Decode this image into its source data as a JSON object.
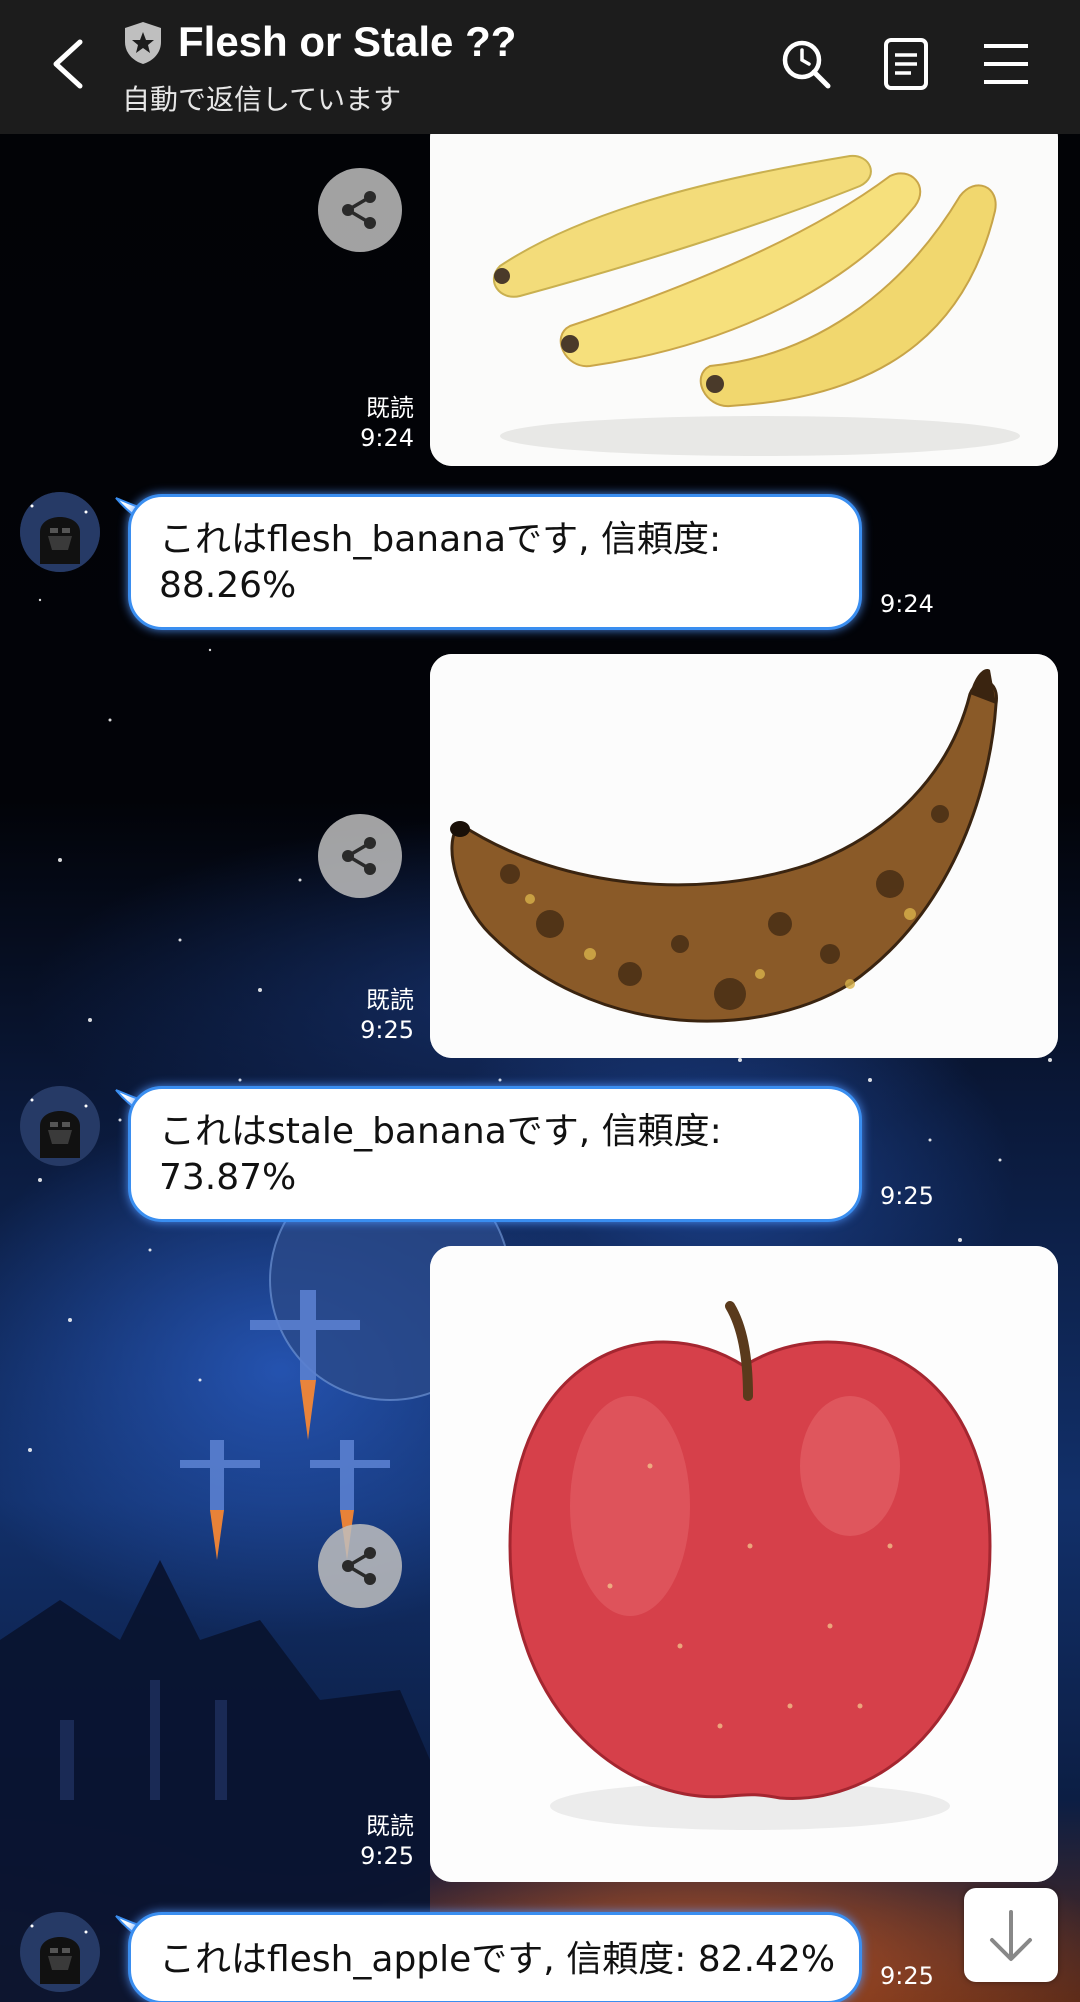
{
  "header": {
    "title": "Flesh or Stale ??",
    "subtitle": "自動で返信しています",
    "icons": [
      "back-arrow-icon",
      "shield-icon",
      "search-icon",
      "notes-icon",
      "menu-icon"
    ]
  },
  "messages": [
    {
      "type": "sent-image",
      "image": "yellow bananas",
      "read": "既読",
      "time": "9:24"
    },
    {
      "type": "received-text",
      "line1": "これはflesh_bananaです, 信頼度:",
      "line2": "88.26%",
      "time": "9:24"
    },
    {
      "type": "sent-image",
      "image": "overripe brown banana",
      "read": "既読",
      "time": "9:25"
    },
    {
      "type": "received-text",
      "line1": "これはstale_bananaです, 信頼度:",
      "line2": "73.87%",
      "time": "9:25"
    },
    {
      "type": "sent-image",
      "image": "red apple",
      "read": "既読",
      "time": "9:25"
    },
    {
      "type": "received-text",
      "line1": "これはflesh_appleです, 信頼度: 82.42%",
      "time": "9:25"
    }
  ],
  "colors": {
    "header_bg": "#1c1c1c",
    "bubble_border": "#3a8ef0",
    "share_btn": "#bebebe"
  }
}
